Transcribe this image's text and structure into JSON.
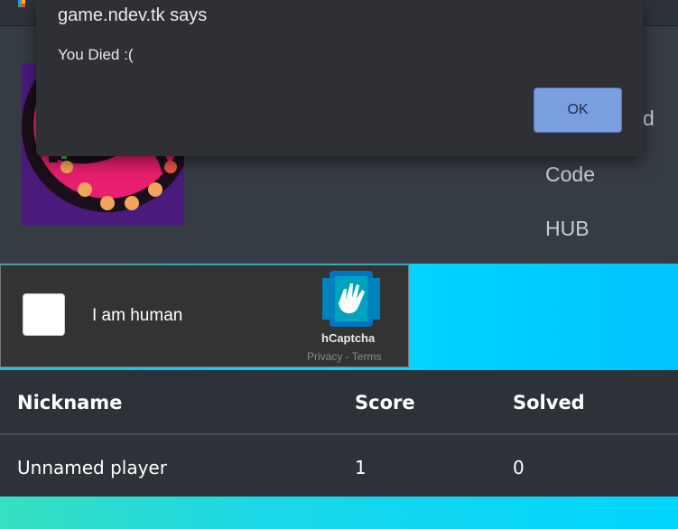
{
  "dialog": {
    "title": "game.ndev.tk says",
    "message": "You Died :(",
    "ok_label": "OK"
  },
  "nav": {
    "items": [
      {
        "label": "d"
      },
      {
        "label": "Code"
      },
      {
        "label": "HUB"
      }
    ]
  },
  "captcha": {
    "label": "I am human",
    "brand": "hCaptcha",
    "privacy": "Privacy",
    "separator": " - ",
    "terms": "Terms"
  },
  "leaderboard": {
    "columns": [
      "Nickname",
      "Score",
      "Solved"
    ],
    "rows": [
      {
        "nickname": "Unnamed player",
        "score": "1",
        "solved": "0"
      }
    ]
  },
  "colors": {
    "accent_cyan": "#00d8ff",
    "dialog_button": "#7a9fe0",
    "table_bg": "#2d3138"
  }
}
